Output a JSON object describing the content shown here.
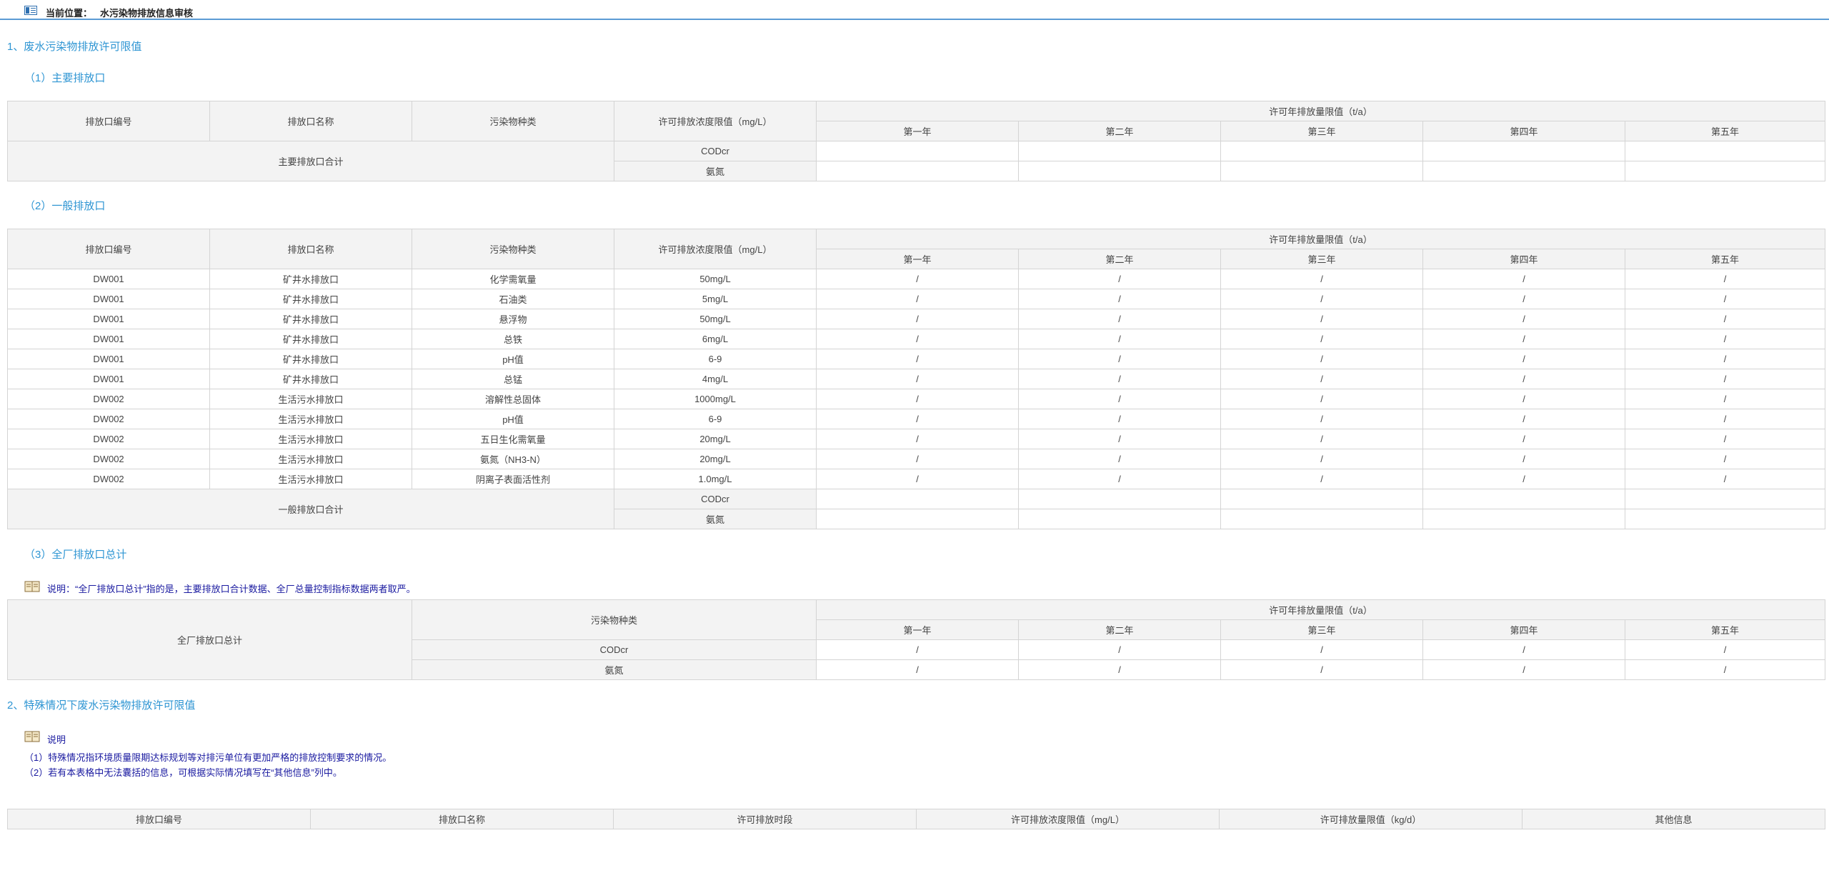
{
  "header": {
    "location_label": "当前位置：",
    "location_value": "水污染物排放信息审核"
  },
  "section1": {
    "title": "1、废水污染物排放许可限值",
    "main_outlet": {
      "title": "（1）主要排放口",
      "headers": {
        "outlet_code": "排放口编号",
        "outlet_name": "排放口名称",
        "pollutant": "污染物种类",
        "concentration": "许可排放浓度限值（mg/L）",
        "annual_limit": "许可年排放量限值（t/a）",
        "years": [
          "第一年",
          "第二年",
          "第三年",
          "第四年",
          "第五年"
        ]
      },
      "total_label": "主要排放口合计",
      "total_pollutants": [
        "CODcr",
        "氨氮"
      ]
    },
    "general_outlet": {
      "title": "（2）一般排放口",
      "headers": {
        "outlet_code": "排放口编号",
        "outlet_name": "排放口名称",
        "pollutant": "污染物种类",
        "concentration": "许可排放浓度限值（mg/L）",
        "annual_limit": "许可年排放量限值（t/a）",
        "years": [
          "第一年",
          "第二年",
          "第三年",
          "第四年",
          "第五年"
        ]
      },
      "rows": [
        {
          "code": "DW001",
          "name": "矿井水排放口",
          "pollutant": "化学需氧量",
          "conc": "50mg/L",
          "y": [
            "/",
            "/",
            "/",
            "/",
            "/"
          ]
        },
        {
          "code": "DW001",
          "name": "矿井水排放口",
          "pollutant": "石油类",
          "conc": "5mg/L",
          "y": [
            "/",
            "/",
            "/",
            "/",
            "/"
          ]
        },
        {
          "code": "DW001",
          "name": "矿井水排放口",
          "pollutant": "悬浮物",
          "conc": "50mg/L",
          "y": [
            "/",
            "/",
            "/",
            "/",
            "/"
          ]
        },
        {
          "code": "DW001",
          "name": "矿井水排放口",
          "pollutant": "总铁",
          "conc": "6mg/L",
          "y": [
            "/",
            "/",
            "/",
            "/",
            "/"
          ]
        },
        {
          "code": "DW001",
          "name": "矿井水排放口",
          "pollutant": "pH值",
          "conc": "6-9",
          "y": [
            "/",
            "/",
            "/",
            "/",
            "/"
          ]
        },
        {
          "code": "DW001",
          "name": "矿井水排放口",
          "pollutant": "总锰",
          "conc": "4mg/L",
          "y": [
            "/",
            "/",
            "/",
            "/",
            "/"
          ]
        },
        {
          "code": "DW002",
          "name": "生活污水排放口",
          "pollutant": "溶解性总固体",
          "conc": "1000mg/L",
          "y": [
            "/",
            "/",
            "/",
            "/",
            "/"
          ]
        },
        {
          "code": "DW002",
          "name": "生活污水排放口",
          "pollutant": "pH值",
          "conc": "6-9",
          "y": [
            "/",
            "/",
            "/",
            "/",
            "/"
          ]
        },
        {
          "code": "DW002",
          "name": "生活污水排放口",
          "pollutant": "五日生化需氧量",
          "conc": "20mg/L",
          "y": [
            "/",
            "/",
            "/",
            "/",
            "/"
          ]
        },
        {
          "code": "DW002",
          "name": "生活污水排放口",
          "pollutant": "氨氮（NH3-N）",
          "conc": "20mg/L",
          "y": [
            "/",
            "/",
            "/",
            "/",
            "/"
          ]
        },
        {
          "code": "DW002",
          "name": "生活污水排放口",
          "pollutant": "阴离子表面活性剂",
          "conc": "1.0mg/L",
          "y": [
            "/",
            "/",
            "/",
            "/",
            "/"
          ]
        }
      ],
      "total_label": "一般排放口合计",
      "total_pollutants": [
        "CODcr",
        "氨氮"
      ]
    },
    "plant_total": {
      "title": "（3）全厂排放口总计",
      "note": "说明：“全厂排放口总计”指的是，主要排放口合计数据、全厂总量控制指标数据两者取严。",
      "label": "全厂排放口总计",
      "pollutant_header": "污染物种类",
      "annual_limit": "许可年排放量限值（t/a）",
      "years": [
        "第一年",
        "第二年",
        "第三年",
        "第四年",
        "第五年"
      ],
      "rows": [
        {
          "pollutant": "CODcr",
          "y": [
            "/",
            "/",
            "/",
            "/",
            "/"
          ]
        },
        {
          "pollutant": "氨氮",
          "y": [
            "/",
            "/",
            "/",
            "/",
            "/"
          ]
        }
      ]
    }
  },
  "section2": {
    "title": "2、特殊情况下废水污染物排放许可限值",
    "note_title": "说明",
    "note_lines": [
      "（1）特殊情况指环境质量限期达标规划等对排污单位有更加严格的排放控制要求的情况。",
      "（2）若有本表格中无法囊括的信息，可根据实际情况填写在“其他信息”列中。"
    ],
    "headers": [
      "排放口编号",
      "排放口名称",
      "许可排放时段",
      "许可排放浓度限值（mg/L）",
      "许可排放量限值（kg/d）",
      "其他信息"
    ]
  },
  "colors": {
    "accent": "#2e95d3",
    "note_text": "#1a1aa0",
    "header_bg": "#f3f3f3",
    "border": "#d4d4d4",
    "topbar_line": "#5b9bd5"
  }
}
